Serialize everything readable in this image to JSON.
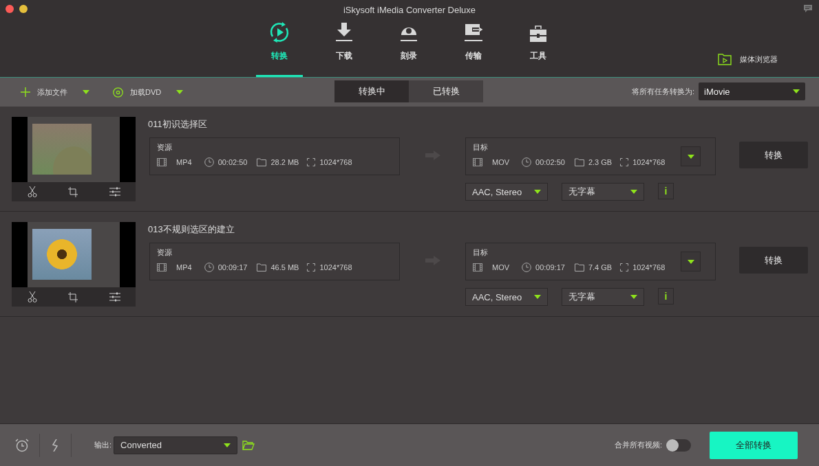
{
  "window": {
    "title": "iSkysoft iMedia Converter Deluxe"
  },
  "nav_tabs": [
    {
      "label": "转换",
      "kind": "convert",
      "selected": true
    },
    {
      "label": "下载",
      "kind": "download",
      "selected": false
    },
    {
      "label": "刻录",
      "kind": "burn",
      "selected": false
    },
    {
      "label": "传输",
      "kind": "transfer",
      "selected": false
    },
    {
      "label": "工具",
      "kind": "toolbox",
      "selected": false
    }
  ],
  "media_browser": {
    "label": "媒体浏览器"
  },
  "toolbar": {
    "add_files": "添加文件",
    "load_dvd": "加载DVD",
    "status_tabs": [
      {
        "label": "转换中",
        "selected": true
      },
      {
        "label": "已转换",
        "selected": false
      }
    ],
    "convert_all_label": "将所有任务转换为:",
    "convert_all_format": "iMovie"
  },
  "tasks": [
    {
      "title": "011初识选择区",
      "source": {
        "label": "资源",
        "format": "MP4",
        "duration": "00:02:50",
        "size": "28.2 MB",
        "resolution": "1024*768"
      },
      "target": {
        "label": "目标",
        "format": "MOV",
        "duration": "00:02:50",
        "size": "2.3 GB",
        "resolution": "1024*768"
      },
      "audio": "AAC, Stereo",
      "subtitle": "无字幕",
      "info": "i",
      "convert_button": "转换"
    },
    {
      "title": "013不规则选区的建立",
      "source": {
        "label": "资源",
        "format": "MP4",
        "duration": "00:09:17",
        "size": "46.5 MB",
        "resolution": "1024*768"
      },
      "target": {
        "label": "目标",
        "format": "MOV",
        "duration": "00:09:17",
        "size": "7.4 GB",
        "resolution": "1024*768"
      },
      "audio": "AAC, Stereo",
      "subtitle": "无字幕",
      "info": "i",
      "convert_button": "转换"
    }
  ],
  "footer": {
    "output_label": "输出:",
    "output_folder": "Converted",
    "merge_label": "合并所有视频:",
    "merge_on": false,
    "convert_all_button": "全部转换"
  }
}
